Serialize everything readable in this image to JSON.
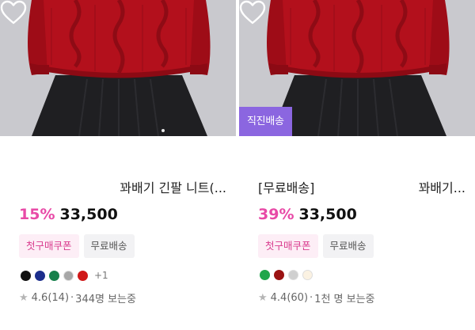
{
  "products": [
    {
      "brand": "",
      "name": "꽈배기 긴팔 니트(...",
      "discount": "15%",
      "price": "33,500",
      "direct_badge": "",
      "tags": [
        "첫구매쿠폰",
        "무료배송"
      ],
      "swatches": [
        "#111111",
        "#1c2e8c",
        "#16804b",
        "#a7a7a7",
        "#d01818"
      ],
      "more_colors": "+1",
      "rating": "4.6(14)",
      "viewers": "344명 보는중",
      "wishlisted": false
    },
    {
      "brand": "[무료배송]",
      "name": "꽈배기...",
      "discount": "39%",
      "price": "33,500",
      "direct_badge": "직진배송",
      "tags": [
        "첫구매쿠폰",
        "무료배송"
      ],
      "swatches": [
        "#1fa64a",
        "#9b1212",
        "#cfcfcf",
        "#fbf2e2"
      ],
      "more_colors": "",
      "rating": "4.4(60)",
      "viewers": "1천 명 보는중",
      "wishlisted": false
    }
  ],
  "colors": {
    "discount": "#e84aa7",
    "direct_badge_bg": "#8b66e0",
    "coupon_bg": "#fdeef6",
    "coupon_text": "#d93d8f",
    "sweater": "#b3101c",
    "skirt": "#1f1f22",
    "backdrop": "#c9c9ce"
  },
  "icons": {
    "wishlist": "heart-outline-icon",
    "rating": "star-icon",
    "carousel": "carousel-dot-icon"
  }
}
